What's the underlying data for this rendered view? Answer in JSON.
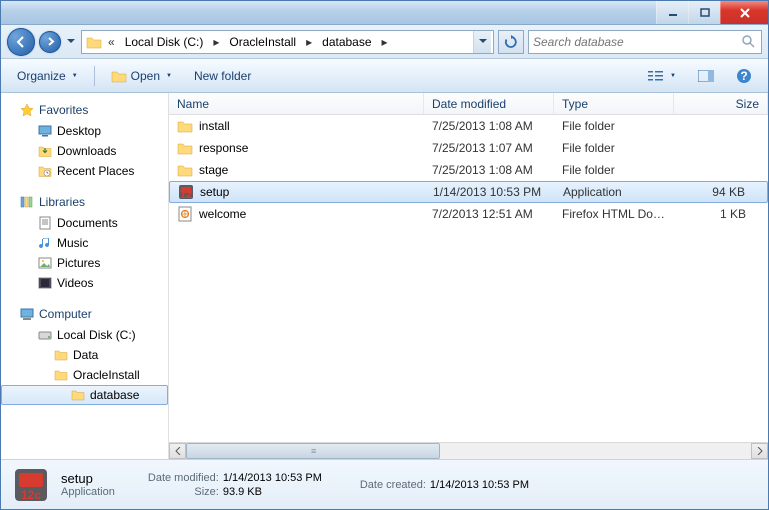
{
  "titlebar": {},
  "address": {
    "crumb_prefix": "«",
    "crumbs": [
      "Local Disk (C:)",
      "OracleInstall",
      "database"
    ]
  },
  "search": {
    "placeholder": "Search database"
  },
  "toolbar": {
    "organize": "Organize",
    "open": "Open",
    "newfolder": "New folder"
  },
  "nav": {
    "favorites": {
      "label": "Favorites",
      "items": [
        "Desktop",
        "Downloads",
        "Recent Places"
      ]
    },
    "libraries": {
      "label": "Libraries",
      "items": [
        "Documents",
        "Music",
        "Pictures",
        "Videos"
      ]
    },
    "computer": {
      "label": "Computer",
      "drive": "Local Disk (C:)",
      "l3": [
        "Data",
        "OracleInstall"
      ],
      "l4": "database"
    }
  },
  "columns": {
    "name": "Name",
    "date": "Date modified",
    "type": "Type",
    "size": "Size"
  },
  "files": [
    {
      "name": "install",
      "date": "7/25/2013 1:08 AM",
      "type": "File folder",
      "size": "",
      "icon": "folder"
    },
    {
      "name": "response",
      "date": "7/25/2013 1:07 AM",
      "type": "File folder",
      "size": "",
      "icon": "folder"
    },
    {
      "name": "stage",
      "date": "7/25/2013 1:08 AM",
      "type": "File folder",
      "size": "",
      "icon": "folder"
    },
    {
      "name": "setup",
      "date": "1/14/2013 10:53 PM",
      "type": "Application",
      "size": "94 KB",
      "icon": "setup",
      "selected": true
    },
    {
      "name": "welcome",
      "date": "7/2/2013 12:51 AM",
      "type": "Firefox HTML Doc...",
      "size": "1 KB",
      "icon": "html"
    }
  ],
  "details": {
    "title": "setup",
    "subtitle": "Application",
    "date_modified_label": "Date modified:",
    "date_modified": "1/14/2013 10:53 PM",
    "size_label": "Size:",
    "size": "93.9 KB",
    "date_created_label": "Date created:",
    "date_created": "1/14/2013 10:53 PM"
  }
}
